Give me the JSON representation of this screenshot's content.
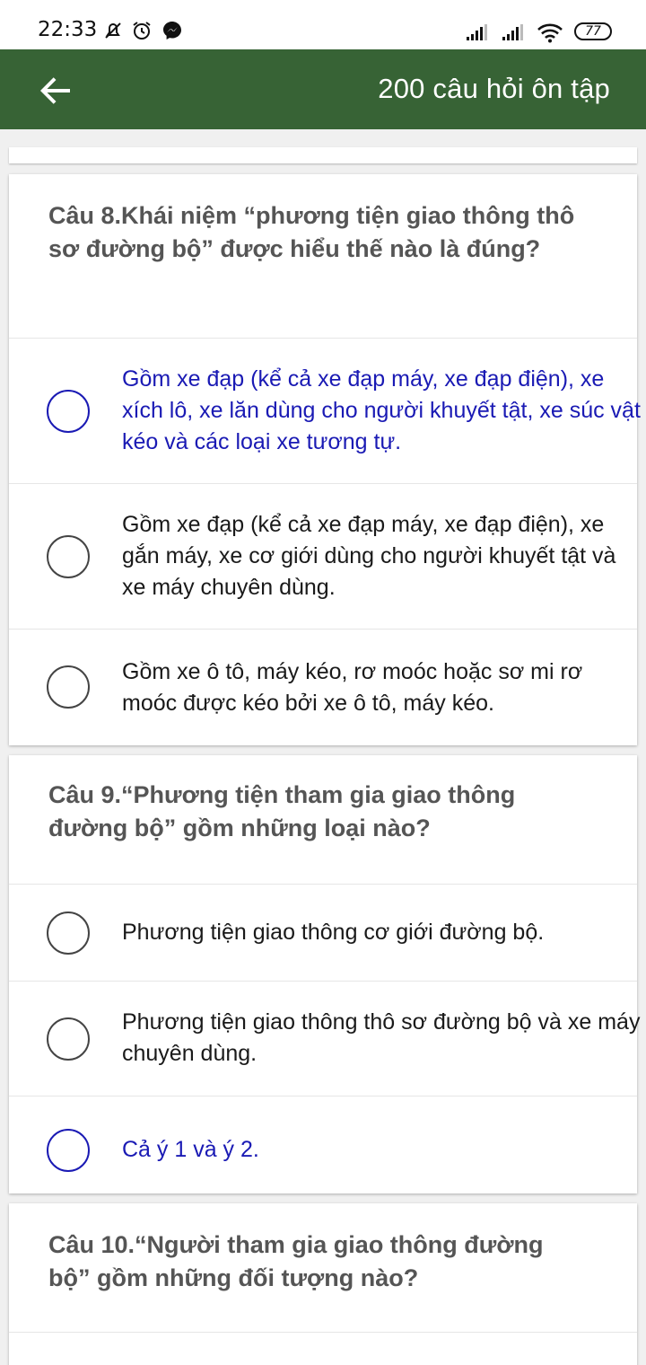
{
  "status_bar": {
    "time": "22:33",
    "battery": "77",
    "icons": [
      "mute-icon",
      "alarm-icon",
      "messenger-icon",
      "signal-icon",
      "signal-icon",
      "wifi-icon",
      "battery-icon"
    ]
  },
  "app_bar": {
    "title": "200 câu hỏi ôn tập",
    "back_icon": "arrow-left-icon"
  },
  "colors": {
    "app_bar": "#376335",
    "answer_highlight": "#1a1ab4"
  },
  "questions": [
    {
      "text": "Câu 8.Khái niệm “phương tiện giao thông thô sơ đường bộ” được hiểu thế nào là đúng?",
      "options": [
        {
          "text": "Gồm xe đạp (kể cả xe đạp máy, xe đạp điện), xe xích lô, xe lăn dùng cho người khuyết tật, xe súc vật kéo và các loại xe tương tự.",
          "highlighted": true
        },
        {
          "text": "Gồm xe đạp (kể cả xe đạp máy, xe đạp điện), xe gắn máy, xe cơ giới dùng cho người khuyết tật và xe máy chuyên dùng.",
          "highlighted": false
        },
        {
          "text": "Gồm xe ô tô, máy kéo, rơ moóc hoặc sơ mi rơ moóc được kéo bởi xe ô tô, máy kéo.",
          "highlighted": false
        }
      ]
    },
    {
      "text": "Câu 9.“Phương tiện tham gia giao thông đường bộ” gồm những loại nào?",
      "options": [
        {
          "text": "Phương tiện giao thông cơ giới đường bộ.",
          "highlighted": false
        },
        {
          "text": "Phương tiện giao thông thô sơ đường bộ và xe máy chuyên dùng.",
          "highlighted": false
        },
        {
          "text": "Cả ý 1 và ý 2.",
          "highlighted": true
        }
      ]
    },
    {
      "text": "Câu 10.“Người tham gia giao thông đường bộ” gồm những đối tượng nào?",
      "options": []
    }
  ]
}
